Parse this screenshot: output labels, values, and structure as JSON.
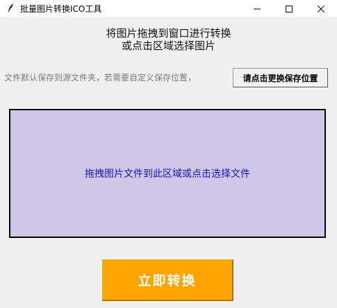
{
  "window": {
    "title": "批量图片转换ICO工具",
    "icon": "feather-icon",
    "controls": [
      "minimize-icon",
      "maximize-icon",
      "close-icon"
    ]
  },
  "headline": {
    "line1": "将图片拖拽到窗口进行转换",
    "line2": "或点击区域选择图片"
  },
  "save_hint": {
    "text": "文件默认保存到源文件夹，若需要自定义保存位置，",
    "button_label": "请点击更换保存位置"
  },
  "drop_zone": {
    "text": "拖拽图片文件到此区域或点击选择文件",
    "background": "#d0c6e8",
    "text_color": "#1616b8"
  },
  "convert": {
    "label": "立即转换",
    "background": "#ffa500"
  }
}
